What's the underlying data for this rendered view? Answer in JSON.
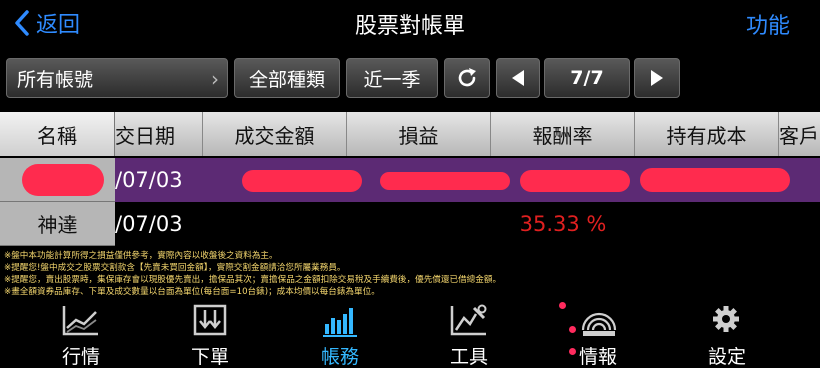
{
  "nav": {
    "back_label": "返回",
    "title": "股票對帳單",
    "action_label": "功能"
  },
  "filters": {
    "account": "所有帳號",
    "type": "全部種類",
    "period": "近一季",
    "page": "7/7"
  },
  "table": {
    "headers": [
      "名稱",
      "交日期",
      "成交金額",
      "損益",
      "報酬率",
      "持有成本",
      "客戶"
    ],
    "rows": [
      {
        "name": "",
        "date": "/07/03",
        "roi": "",
        "redacted": true
      },
      {
        "name": "神達",
        "date": "/07/03",
        "roi": "35.33 %",
        "redacted": false
      }
    ]
  },
  "notes": [
    "※盤中本功能計算所得之損益僅供參考，實際內容以收盤後之資料為主。",
    "※提醒您!盤中成交之股票交割款含【先賣未買回金額】，實際交割金額請洽您所屬業務員。",
    "※提醒您，賣出股票時，集保庫存會以現股優先賣出，擔保品其次；賣擔保品之金額扣除交易稅及手續費後，優先償還已借總金額。",
    "※畫全額資券品庫存、下單及成交數量以台面為單位(每台面=10台錶)；成本均價以每台錶為單位。"
  ],
  "tabbar": [
    {
      "label": "行情",
      "icon": "chart-line-icon",
      "active": false
    },
    {
      "label": "下單",
      "icon": "order-icon",
      "active": false
    },
    {
      "label": "帳務",
      "icon": "account-bars-icon",
      "active": true
    },
    {
      "label": "工具",
      "icon": "tools-icon",
      "active": false
    },
    {
      "label": "情報",
      "icon": "news-radar-icon",
      "active": false
    },
    {
      "label": "設定",
      "icon": "gear-icon",
      "active": false
    }
  ],
  "colors": {
    "accent": "#2f8bff",
    "active_tab": "#34b8ff",
    "highlight_row": "#5c2a74",
    "profit": "#e02020",
    "notes": "#f5d76e"
  }
}
